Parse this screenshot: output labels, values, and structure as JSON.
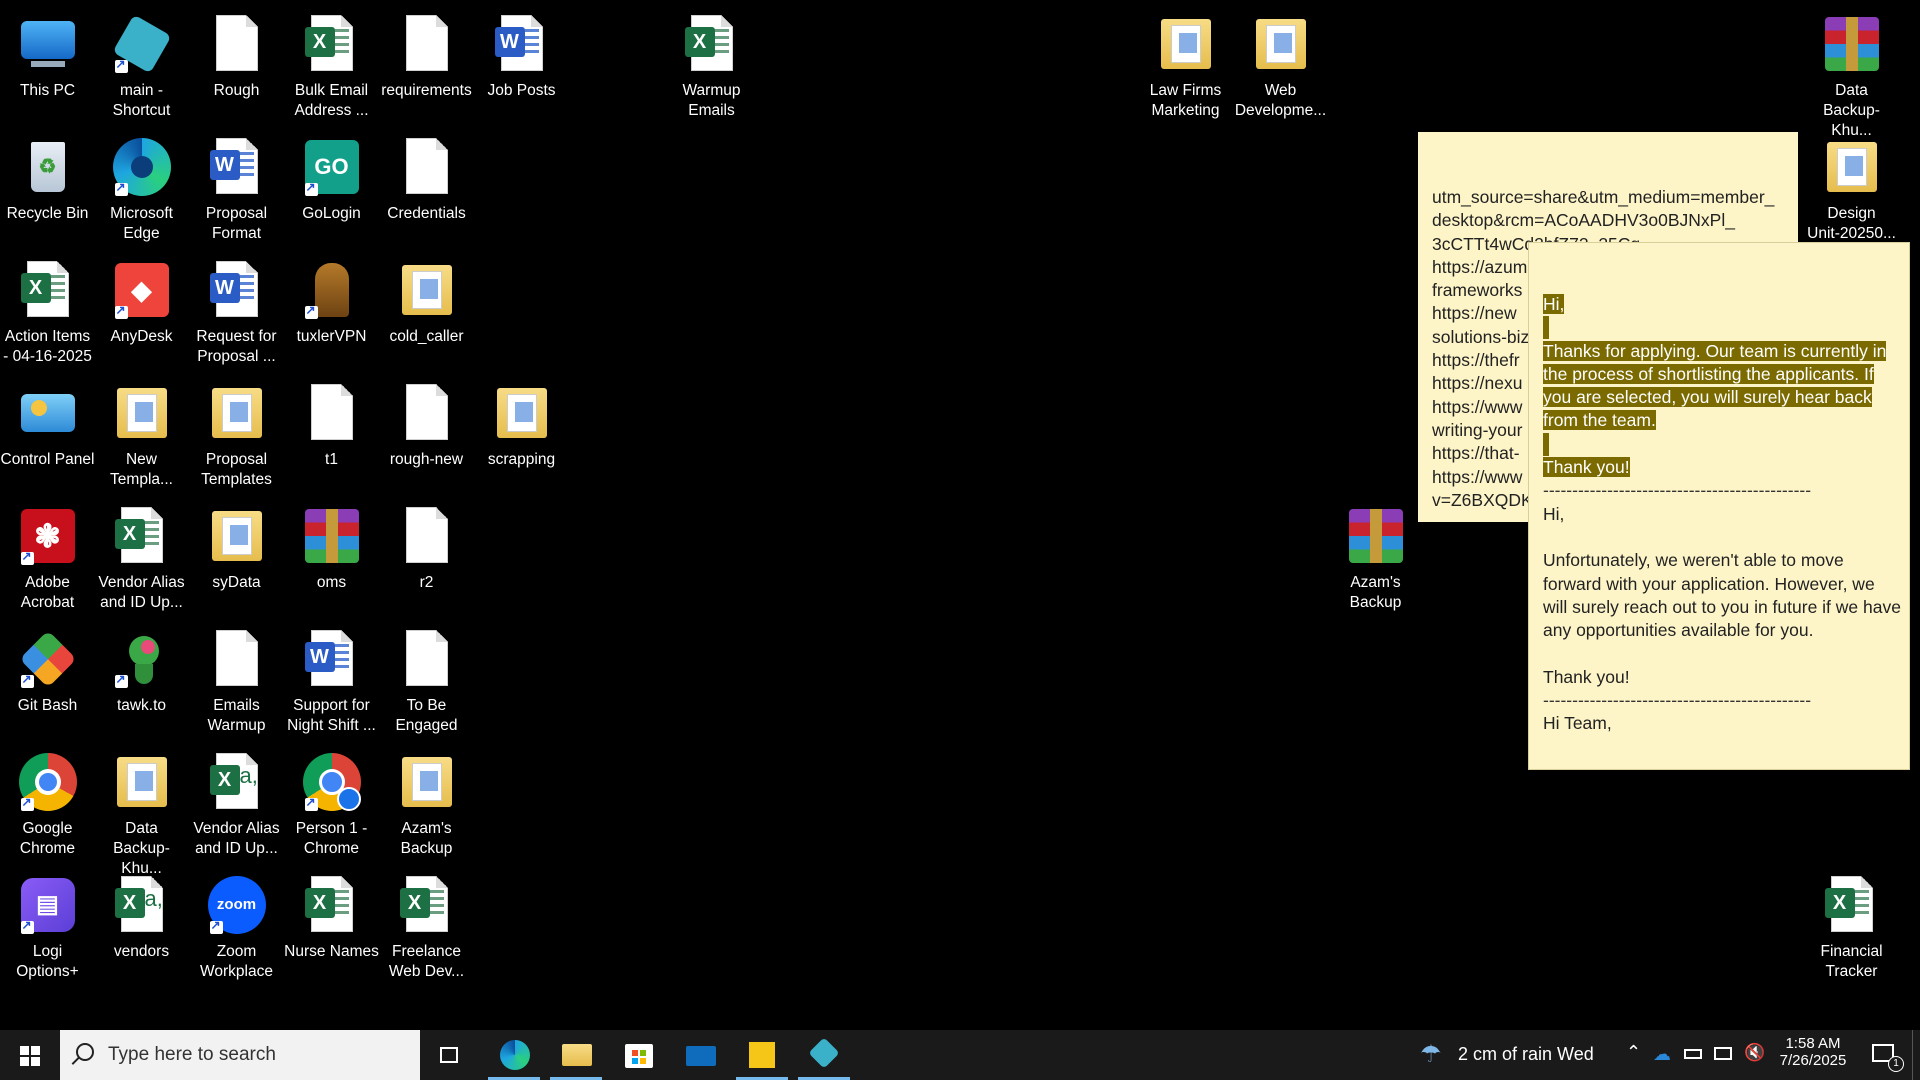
{
  "desktop": {
    "icons": [
      {
        "label": "This PC"
      },
      {
        "label": "main -\nShortcut"
      },
      {
        "label": "Rough"
      },
      {
        "label": "Bulk Email\nAddress ..."
      },
      {
        "label": "requirements"
      },
      {
        "label": "Job Posts"
      },
      {
        "label": "Warmup\nEmails"
      },
      {
        "label": "Law Firms\nMarketing"
      },
      {
        "label": "Web\nDevelopme..."
      },
      {
        "label": "Data\nBackup-Khu..."
      },
      {
        "label": "Recycle Bin"
      },
      {
        "label": "Microsoft\nEdge"
      },
      {
        "label": "Proposal\nFormat"
      },
      {
        "label": "GoLogin"
      },
      {
        "label": "Credentials"
      },
      {
        "label": "Design\nUnit-20250..."
      },
      {
        "label": "Action Items\n- 04-16-2025"
      },
      {
        "label": "AnyDesk"
      },
      {
        "label": "Request for\nProposal ..."
      },
      {
        "label": "tuxlerVPN"
      },
      {
        "label": "cold_caller"
      },
      {
        "label": "Control Panel"
      },
      {
        "label": "New\nTempla..."
      },
      {
        "label": "Proposal\nTemplates"
      },
      {
        "label": "t1"
      },
      {
        "label": "rough-new"
      },
      {
        "label": "scrapping"
      },
      {
        "label": "Adobe\nAcrobat"
      },
      {
        "label": "Vendor Alias\nand ID Up..."
      },
      {
        "label": "syData"
      },
      {
        "label": "oms"
      },
      {
        "label": "r2"
      },
      {
        "label": "Azam's\nBackup"
      },
      {
        "label": "Git Bash"
      },
      {
        "label": "tawk.to"
      },
      {
        "label": "Emails\nWarmup"
      },
      {
        "label": "Support for\nNight Shift ..."
      },
      {
        "label": "To Be\nEngaged"
      },
      {
        "label": "Google\nChrome"
      },
      {
        "label": "Data\nBackup-Khu..."
      },
      {
        "label": "Vendor Alias\nand ID Up..."
      },
      {
        "label": "Person 1 -\nChrome"
      },
      {
        "label": "Azam's\nBackup"
      },
      {
        "label": "Logi\nOptions+"
      },
      {
        "label": "vendors"
      },
      {
        "label": "Zoom\nWorkplace"
      },
      {
        "label": "Nurse Names"
      },
      {
        "label": "Freelance\nWeb Dev..."
      },
      {
        "label": "Financial\nTracker"
      }
    ]
  },
  "sticky_back": {
    "text": "utm_source=share&utm_medium=member_\ndesktop&rcm=ACoAADHV3o0BJNxPl_\n3cCTTt4wCd2bfZ72_25Cg\nhttps://azum\nframeworks\nhttps://new\nsolutions-biz\nhttps://thefr\nhttps://nexu\nhttps://www\nwriting-your\nhttps://that-\nhttps://www\nv=Z6BXQDK"
  },
  "sticky_front": {
    "hl_hi": "Hi,",
    "hl_para": "Thanks for applying. Our team is currently in the process of shortlisting the applicants. If you are selected, you will surely hear back from the team.",
    "hl_thanks": "Thank you!",
    "divider": "----------------------------------------------",
    "hi2": "Hi,",
    "para2": "Unfortunately, we weren't able to move forward with your application. However, we will surely reach out to you in future if we have any opportunities available for you.",
    "thanks2": "Thank you!",
    "hiteam": "Hi Team,"
  },
  "taskbar": {
    "search_placeholder": "Type here to search",
    "weather": "2 cm of rain  Wed",
    "time": "1:58 AM",
    "date": "7/26/2025",
    "notif_count": "1"
  }
}
